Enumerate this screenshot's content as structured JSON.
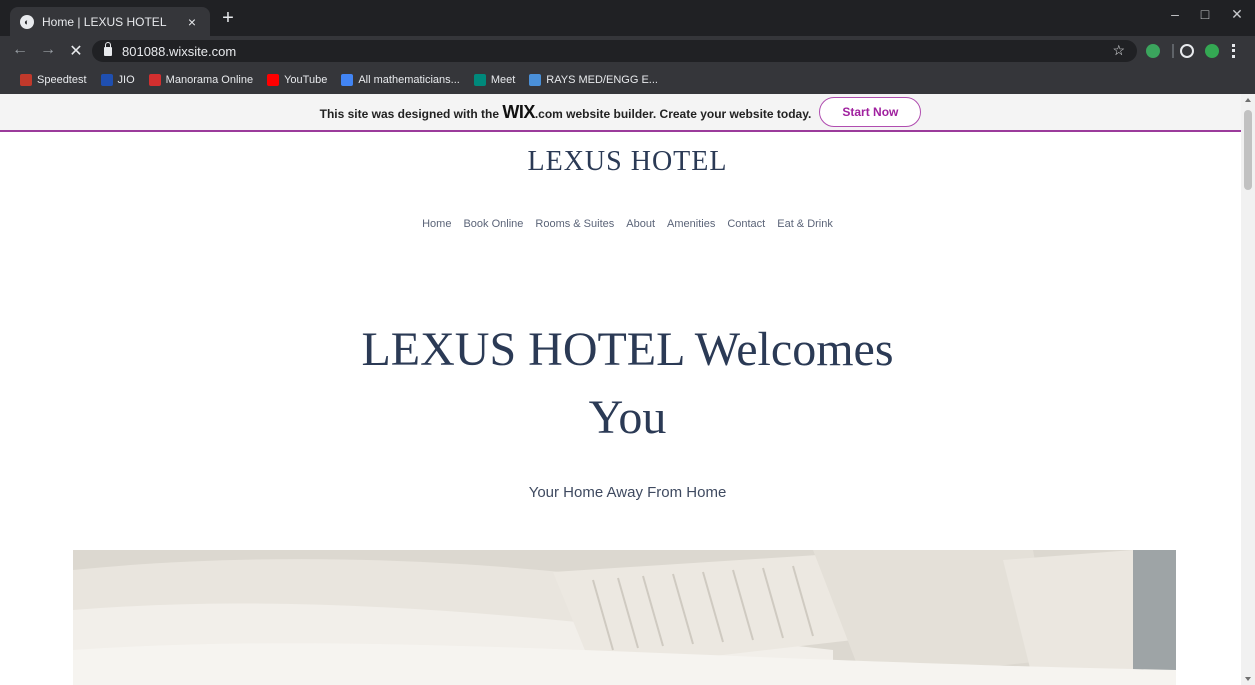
{
  "browser": {
    "tab": {
      "title": "Home | LEXUS HOTEL",
      "close_glyph": "×"
    },
    "new_tab_glyph": "+",
    "window_controls": {
      "minimize": "–",
      "maximize": "□",
      "close": "✕"
    },
    "nav": {
      "back": "←",
      "forward": "→",
      "stop": "✕"
    },
    "url": "801088.wixsite.com",
    "star_glyph": "☆",
    "bookmarks": [
      {
        "label": "Speedtest",
        "icon": "speedtest-icon",
        "color": "#c0392b"
      },
      {
        "label": "JIO",
        "icon": "jio-icon",
        "color": "#1f4fb0"
      },
      {
        "label": "Manorama Online",
        "icon": "manorama-icon",
        "color": "#d32f2f"
      },
      {
        "label": "YouTube",
        "icon": "youtube-icon",
        "color": "#ff0000"
      },
      {
        "label": "All mathematicians...",
        "icon": "google-icon",
        "color": "#4285f4"
      },
      {
        "label": "Meet",
        "icon": "meet-icon",
        "color": "#00897b"
      },
      {
        "label": "RAYS MED/ENGG E...",
        "icon": "doc-icon",
        "color": "#4a90d9"
      }
    ]
  },
  "wix_banner": {
    "before": "This site was designed with the ",
    "brand": "WIX",
    "after": ".com website builder. Create your website today.",
    "button": "Start Now"
  },
  "site": {
    "title": "LEXUS HOTEL",
    "nav": [
      "Home",
      "Book Online",
      "Rooms & Suites",
      "About",
      "Amenities",
      "Contact",
      "Eat & Drink"
    ],
    "hero_line1": "LEXUS HOTEL Welcomes",
    "hero_line2": "You",
    "subtitle": "Your Home Away From Home"
  },
  "colors": {
    "accent": "#9b3b9b",
    "heading": "#2b3a55",
    "chrome_dark": "#202124",
    "chrome_mid": "#35363a"
  }
}
